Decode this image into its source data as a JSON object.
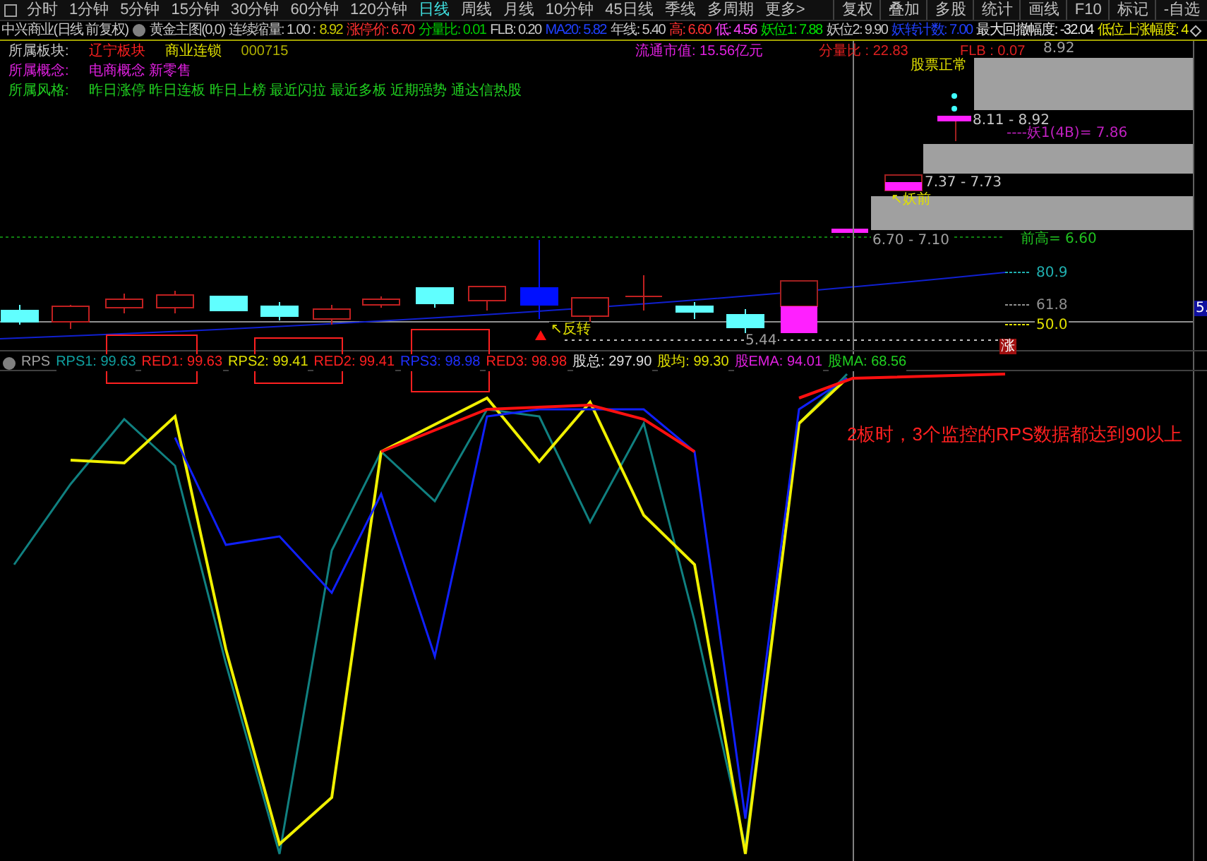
{
  "toolbar": {
    "periods": [
      {
        "label": "分时",
        "selected": false
      },
      {
        "label": "1分钟",
        "selected": false
      },
      {
        "label": "5分钟",
        "selected": false
      },
      {
        "label": "15分钟",
        "selected": false
      },
      {
        "label": "30分钟",
        "selected": false
      },
      {
        "label": "60分钟",
        "selected": false
      },
      {
        "label": "120分钟",
        "selected": false
      },
      {
        "label": "日线",
        "selected": true
      },
      {
        "label": "周线",
        "selected": false
      },
      {
        "label": "月线",
        "selected": false
      },
      {
        "label": "10分钟",
        "selected": false
      },
      {
        "label": "45日线",
        "selected": false
      },
      {
        "label": "季线",
        "selected": false
      },
      {
        "label": "多周期",
        "selected": false
      },
      {
        "label": "更多>",
        "selected": false
      }
    ],
    "buttons": [
      "复权",
      "叠加",
      "多股",
      "统计",
      "画线",
      "F10",
      "标记",
      "-自选"
    ]
  },
  "info_bar": {
    "items": [
      {
        "text": "中兴商业(日线 前复权)",
        "color": "#c8c8c8"
      },
      {
        "text": "黄金主图(0,0)",
        "color": "#c8c8c8"
      },
      {
        "text": "连续缩量: 1.00 :",
        "color": "#c8c8c8"
      },
      {
        "text": "8.92",
        "color": "#c8c800"
      },
      {
        "text": "涨停价: 6.70",
        "color": "#ff3030"
      },
      {
        "text": "分量比: 0.01",
        "color": "#00c800"
      },
      {
        "text": "FLB: 0.20",
        "color": "#c8c8c8"
      },
      {
        "text": "MA20: 5.82",
        "color": "#2040ff"
      },
      {
        "text": "年线: 5.40",
        "color": "#c8c8c8"
      },
      {
        "text": "高: 6.60",
        "color": "#ff3030"
      },
      {
        "text": "低: 4.56",
        "color": "#ff40ff"
      },
      {
        "text": "妖位1: 7.88",
        "color": "#00e000"
      },
      {
        "text": "妖位2: 9.90",
        "color": "#c8c8c8"
      },
      {
        "text": "妖转计数: 7.00",
        "color": "#2040ff"
      },
      {
        "text": "最大回撤幅度: -32.04",
        "color": "#e8e8e8"
      },
      {
        "text": "低位上涨幅度: 4",
        "color": "#e8e800"
      }
    ]
  },
  "stock_info": {
    "rows": [
      {
        "label": {
          "text": "所属板块:",
          "color": "#c8c8c8"
        },
        "values": [
          {
            "text": "辽宁板块",
            "color": "#ff2020"
          },
          {
            "text": "商业连锁",
            "color": "#e0e000"
          },
          {
            "text": "000715",
            "color": "#b0b000"
          }
        ]
      },
      {
        "label": {
          "text": "所属概念:",
          "color": "#e020e0"
        },
        "values": [
          {
            "text": "电商概念 新零售",
            "color": "#e020e0"
          }
        ]
      },
      {
        "label": {
          "text": "所属风格:",
          "color": "#20d020"
        },
        "values": [
          {
            "text": "昨日涨停 昨日连板 昨日上榜 最近闪拉 最近多板 近期强势 通达信热股",
            "color": "#20d020"
          }
        ]
      }
    ]
  },
  "market": [
    {
      "text": "流通市值: 15.56亿元",
      "color": "#e020e0"
    },
    {
      "text": "分量比 : 22.83",
      "color": "#e02020"
    },
    {
      "text": "FLB : 0.07",
      "color": "#e02020"
    },
    {
      "text": "股票正常",
      "color": "#e0e000"
    }
  ],
  "price_chart": {
    "labels": [
      {
        "text": "8.92",
        "color": "#a0a0a0"
      },
      {
        "text": "8.11 - 8.92",
        "color": "#c8c8c8"
      },
      {
        "text": "----妖1(4B)= 7.86",
        "color": "#c020c0"
      },
      {
        "text": "7.37 - 7.73",
        "color": "#c8c8c8"
      },
      {
        "text": "↖妖前",
        "color": "#e0e000"
      },
      {
        "text": "6.70 - 7.10",
        "color": "#a0a0a0"
      },
      {
        "text": "前高= 6.60",
        "color": "#20c020"
      },
      {
        "text": "80.9",
        "color": "#20b0b0"
      },
      {
        "text": "61.8",
        "color": "#909090"
      },
      {
        "text": "50.0",
        "color": "#e0e000"
      },
      {
        "text": "↖反转",
        "color": "#e0e000"
      },
      {
        "text": "5.44",
        "color": "#a0a0a0"
      },
      {
        "text": "涨",
        "color": "#a01010"
      },
      {
        "text": "5.",
        "color": "#1010a0"
      }
    ]
  },
  "rps": {
    "title": "RPS",
    "indicators": [
      {
        "text": "RPS1: 99.63",
        "color": "#10a0a0"
      },
      {
        "text": "RED1: 99.63",
        "color": "#ff2020"
      },
      {
        "text": "RPS2: 99.41",
        "color": "#e0e000"
      },
      {
        "text": "RED2: 99.41",
        "color": "#ff2020"
      },
      {
        "text": "RPS3: 98.98",
        "color": "#2030ff"
      },
      {
        "text": "RED3: 98.98",
        "color": "#ff2020"
      },
      {
        "text": "股总: 297.90",
        "color": "#e0e0e0"
      },
      {
        "text": "股均: 99.30",
        "color": "#e0e000"
      },
      {
        "text": "股EMA: 94.01",
        "color": "#e020e0"
      },
      {
        "text": "股MA: 68.56",
        "color": "#20d020"
      }
    ],
    "annotation": "2板时，3个监控的RPS数据都达到90以上"
  }
}
